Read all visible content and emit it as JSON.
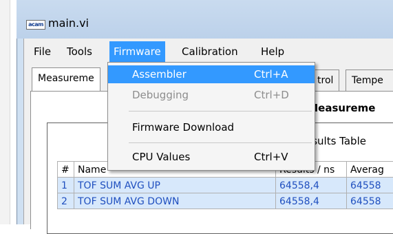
{
  "window": {
    "title": "main.vi",
    "icon_text": "acam"
  },
  "menubar": {
    "items": [
      {
        "label": "File"
      },
      {
        "label": "Tools"
      },
      {
        "label": "Firmware"
      },
      {
        "label": "Calibration"
      },
      {
        "label": "Help"
      }
    ]
  },
  "firmware_menu": {
    "items": [
      {
        "label": "Assembler",
        "shortcut": "Ctrl+A",
        "state": "highlighted"
      },
      {
        "label": "Debugging",
        "shortcut": "Ctrl+D",
        "state": "disabled"
      },
      {
        "label": "Firmware Download",
        "shortcut": "",
        "state": "enabled"
      },
      {
        "label": "CPU Values",
        "shortcut": "Ctrl+V",
        "state": "enabled"
      }
    ]
  },
  "tabs": [
    {
      "label": "Measureme",
      "selected": true
    },
    {
      "label": "trol",
      "selected": false
    },
    {
      "label": "Tempe",
      "selected": false
    }
  ],
  "panel": {
    "section_title": "ic Measureme",
    "results_label": "esults Table"
  },
  "results_table": {
    "columns": [
      "#",
      "Name",
      "Results / ns",
      "Averag"
    ],
    "rows": [
      {
        "index": "1",
        "name": "TOF SUM AVG UP",
        "result": "64558,4",
        "average": "64558"
      },
      {
        "index": "2",
        "name": "TOF SUM AVG DOWN",
        "result": "64558,4",
        "average": "64558"
      }
    ]
  },
  "colors": {
    "highlight": "#3399ff",
    "row_background": "#d7e8fb",
    "row_text": "#1f4fbf",
    "titlebar": "#c9dbef"
  }
}
